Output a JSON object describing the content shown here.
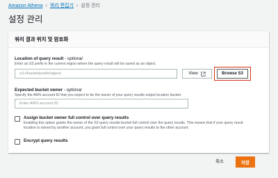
{
  "breadcrumb": {
    "items": [
      "Amazon Athena",
      "쿼리 편집기",
      "설정 관리"
    ]
  },
  "page": {
    "title": "설정 관리"
  },
  "panel": {
    "title": "쿼리 결과 위치 및 암호화"
  },
  "location": {
    "label": "Location of query result",
    "optional": "- optional",
    "description": "Enter an S3 prefix in the current region where the query result will be saved as an object.",
    "placeholder": "s3://bucket/prefix/object/",
    "view_button": "View",
    "browse_button": "Browse S3"
  },
  "owner": {
    "label": "Expected bucket owner",
    "optional": "- optional",
    "description": "Specify the AWS account ID that you expect to be the owner of your query results output location bucket.",
    "placeholder": "Enter AWS account ID"
  },
  "full_control": {
    "label": "Assign bucket owner full control over query results",
    "description": "Enabling this option grants the owner of the S3 query results bucket full control over the query results. This means that if your query result location is owned by another account, you grant full control over your query results to the other account."
  },
  "encrypt": {
    "label": "Encrypt query results"
  },
  "footer": {
    "cancel": "취소",
    "save": "저장"
  },
  "colors": {
    "accent": "#ec7211",
    "link": "#0073bb",
    "highlight": "#d13212"
  },
  "icons": {
    "view": "external-link-icon",
    "separator": "chevron-right-icon"
  }
}
